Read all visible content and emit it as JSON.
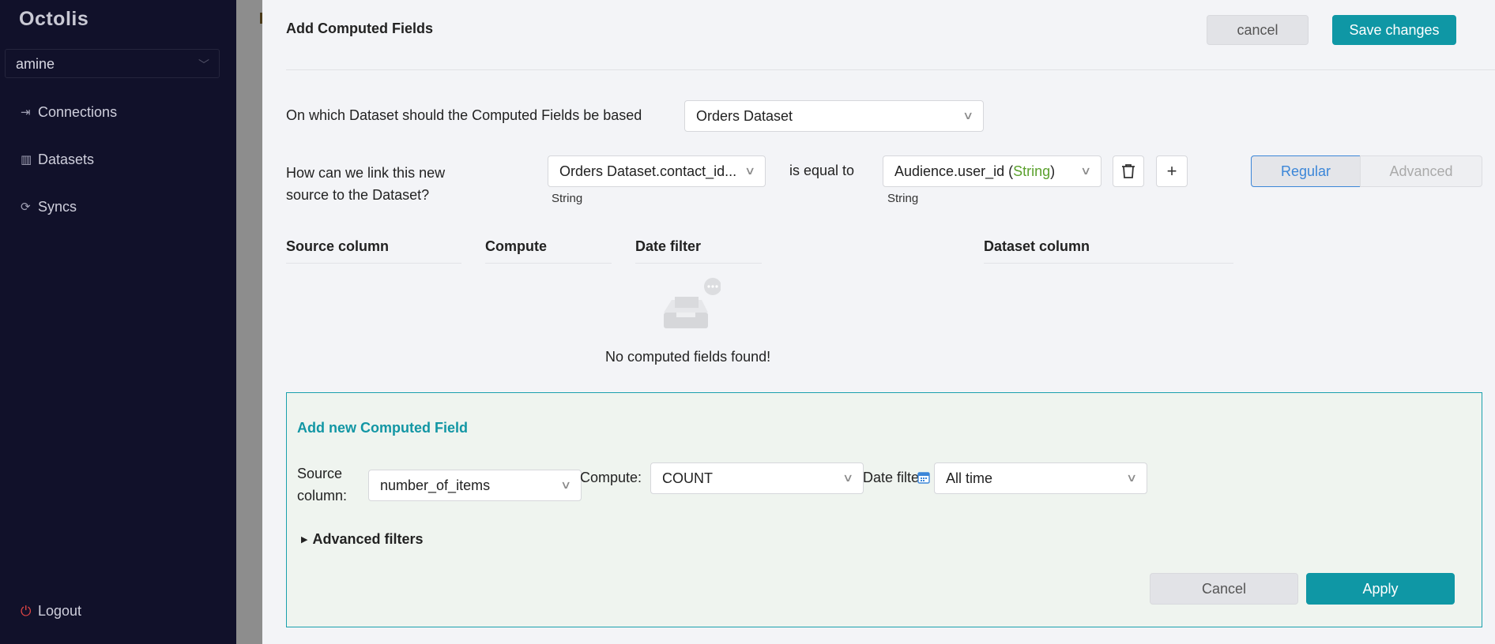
{
  "sidebar": {
    "logo": "Octolis",
    "account": "amine",
    "items": [
      {
        "label": "Connections",
        "icon": "connections-icon"
      },
      {
        "label": "Datasets",
        "icon": "datasets-icon"
      },
      {
        "label": "Syncs",
        "icon": "syncs-icon"
      }
    ],
    "logout": "Logout"
  },
  "drawer": {
    "title": "Add Computed Fields",
    "cancel_label": "cancel",
    "save_label": "Save changes"
  },
  "dataset": {
    "question": "On which Dataset should the Computed Fields be based",
    "value": "Orders Dataset"
  },
  "link": {
    "question_line1": "How can we link this new",
    "question_line2": "source to the Dataset?",
    "left_value": "Orders Dataset.contact_id...",
    "left_type": "String",
    "operator": "is equal to",
    "right_value_prefix": "Audience.user_id (",
    "right_value_type": "String",
    "right_value_suffix": ")",
    "right_type": "String"
  },
  "mode": {
    "regular": "Regular",
    "advanced": "Advanced"
  },
  "table": {
    "headers": [
      "Source column",
      "Compute",
      "Date filter",
      "Dataset column"
    ],
    "empty_text": "No computed fields found!"
  },
  "add_new": {
    "title": "Add new Computed Field",
    "source_label_line1": "Source",
    "source_label_line2": "column:",
    "source_value": "number_of_items",
    "compute_label": "Compute:",
    "compute_value": "COUNT",
    "date_filter_label": "Date filter",
    "date_filter_value": "All time",
    "advanced_filters": "Advanced filters",
    "cancel_label": "Cancel",
    "apply_label": "Apply"
  },
  "colors": {
    "sidebar_bg": "#11112a",
    "accent": "#0f97a5",
    "segment_active": "#3b86d8",
    "type_green": "#5aa02c",
    "logout_red": "#e04545"
  }
}
